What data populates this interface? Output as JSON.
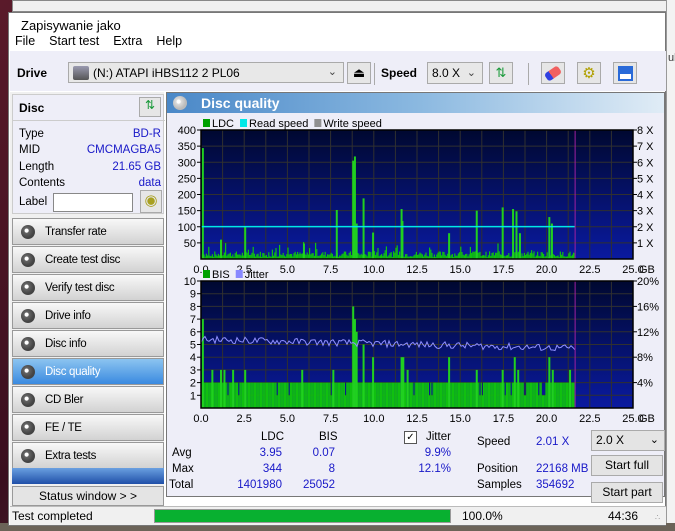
{
  "window": {
    "title": "Zapisywanie jako",
    "side_text": "uk"
  },
  "menu": [
    "File",
    "Start test",
    "Extra",
    "Help"
  ],
  "toolbar": {
    "drive_label": "Drive",
    "drive_value": "(N:)   ATAPI iHBS112   2 PL06",
    "speed_label": "Speed",
    "speed_value": "8.0 X"
  },
  "disc": {
    "header": "Disc",
    "rows": [
      {
        "label": "Type",
        "value": "BD-R"
      },
      {
        "label": "MID",
        "value": "CMCMAGBA5"
      },
      {
        "label": "Length",
        "value": "21.65 GB"
      },
      {
        "label": "Contents",
        "value": "data"
      }
    ],
    "label_field_label": "Label",
    "label_field_value": ""
  },
  "nav": [
    {
      "label": "Transfer rate",
      "active": false
    },
    {
      "label": "Create test disc",
      "active": false
    },
    {
      "label": "Verify test disc",
      "active": false
    },
    {
      "label": "Drive info",
      "active": false
    },
    {
      "label": "Disc info",
      "active": false
    },
    {
      "label": "Disc quality",
      "active": true
    },
    {
      "label": "CD Bler",
      "active": false
    },
    {
      "label": "FE / TE",
      "active": false
    },
    {
      "label": "Extra tests",
      "active": false
    }
  ],
  "status_window_label": "Status window > >",
  "main": {
    "title": "Disc quality"
  },
  "chart_data": [
    {
      "type": "bar",
      "title": "LDC",
      "legend": [
        {
          "name": "LDC",
          "color": "#00a000"
        },
        {
          "name": "Read speed",
          "color": "#00e8e8"
        },
        {
          "name": "Write speed",
          "color": "#909090"
        }
      ],
      "xlabel": "GB",
      "xlim": [
        0,
        25
      ],
      "xticks": [
        "0.0",
        "2.5",
        "5.0",
        "7.5",
        "10.0",
        "12.5",
        "15.0",
        "17.5",
        "20.0",
        "22.5",
        "25.0"
      ],
      "ylim": [
        0,
        400
      ],
      "yticks": [
        "50",
        "100",
        "150",
        "200",
        "250",
        "300",
        "350",
        "400"
      ],
      "y2lim": [
        0,
        8
      ],
      "y2ticks": [
        "1 X",
        "2 X",
        "3 X",
        "4 X",
        "5 X",
        "6 X",
        "7 X",
        "8 X"
      ],
      "disc_end_gb": 21.65,
      "read_speed_x": 2.01,
      "spikes": [
        {
          "x": 0.05,
          "y": 344
        },
        {
          "x": 1.1,
          "y": 60
        },
        {
          "x": 2.5,
          "y": 100
        },
        {
          "x": 5.9,
          "y": 48
        },
        {
          "x": 7.8,
          "y": 152
        },
        {
          "x": 8.75,
          "y": 305
        },
        {
          "x": 8.85,
          "y": 318
        },
        {
          "x": 8.95,
          "y": 110
        },
        {
          "x": 9.35,
          "y": 188
        },
        {
          "x": 9.9,
          "y": 82
        },
        {
          "x": 11.55,
          "y": 155
        },
        {
          "x": 11.6,
          "y": 118
        },
        {
          "x": 14.3,
          "y": 80
        },
        {
          "x": 15.9,
          "y": 150
        },
        {
          "x": 17.4,
          "y": 160
        },
        {
          "x": 18.0,
          "y": 155
        },
        {
          "x": 18.2,
          "y": 148
        },
        {
          "x": 18.4,
          "y": 80
        },
        {
          "x": 20.1,
          "y": 130
        },
        {
          "x": 20.25,
          "y": 110
        }
      ],
      "baseline_avg": 15
    },
    {
      "type": "bar",
      "title": "BIS / Jitter",
      "legend": [
        {
          "name": "BIS",
          "color": "#00a000"
        },
        {
          "name": "Jitter",
          "color": "#8888ff"
        }
      ],
      "xlabel": "GB",
      "xlim": [
        0,
        25
      ],
      "xticks": [
        "0.0",
        "2.5",
        "5.0",
        "7.5",
        "10.0",
        "12.5",
        "15.0",
        "17.5",
        "20.0",
        "22.5",
        "25.0"
      ],
      "ylim": [
        0,
        10
      ],
      "yticks": [
        "1",
        "2",
        "3",
        "4",
        "5",
        "6",
        "7",
        "8",
        "9",
        "10"
      ],
      "y2lim": [
        0,
        20
      ],
      "y2ticks": [
        "4%",
        "8%",
        "12%",
        "16%",
        "20%"
      ],
      "disc_end_gb": 21.65,
      "bis_baseline": 2,
      "bis_spikes": [
        {
          "x": 0.05,
          "y": 7
        },
        {
          "x": 0.6,
          "y": 3
        },
        {
          "x": 1.1,
          "y": 3
        },
        {
          "x": 1.3,
          "y": 3
        },
        {
          "x": 1.8,
          "y": 3
        },
        {
          "x": 2.5,
          "y": 3
        },
        {
          "x": 5.8,
          "y": 3
        },
        {
          "x": 7.6,
          "y": 3
        },
        {
          "x": 8.75,
          "y": 8
        },
        {
          "x": 8.85,
          "y": 7
        },
        {
          "x": 8.95,
          "y": 6
        },
        {
          "x": 9.35,
          "y": 5
        },
        {
          "x": 9.9,
          "y": 4
        },
        {
          "x": 11.55,
          "y": 4
        },
        {
          "x": 11.65,
          "y": 4
        },
        {
          "x": 11.9,
          "y": 3
        },
        {
          "x": 14.3,
          "y": 4
        },
        {
          "x": 15.9,
          "y": 3
        },
        {
          "x": 17.4,
          "y": 3
        },
        {
          "x": 18.1,
          "y": 4
        },
        {
          "x": 18.3,
          "y": 3
        },
        {
          "x": 20.1,
          "y": 4
        },
        {
          "x": 20.3,
          "y": 3
        },
        {
          "x": 21.3,
          "y": 3
        }
      ],
      "jitter_percent_start": 10.8,
      "jitter_percent_end": 9.4,
      "jitter_percent_avg": 9.9
    }
  ],
  "stats": {
    "col_ldc": "LDC",
    "col_bis": "BIS",
    "jitter_label": "Jitter",
    "jitter_checked": true,
    "rows": [
      {
        "label": "Avg",
        "ldc": "3.95",
        "bis": "0.07",
        "jitter": "9.9%"
      },
      {
        "label": "Max",
        "ldc": "344",
        "bis": "8",
        "jitter": "12.1%"
      },
      {
        "label": "Total",
        "ldc": "1401980",
        "bis": "25052",
        "jitter": ""
      }
    ],
    "speed_label": "Speed",
    "speed_value": "2.01 X",
    "position_label": "Position",
    "position_value": "22168 MB",
    "samples_label": "Samples",
    "samples_value": "354692",
    "speed_select": "2.0 X",
    "start_full": "Start full",
    "start_part": "Start part"
  },
  "statusbar": {
    "text": "Test completed",
    "progress": 100.0,
    "progress_text": "100.0%",
    "time": "44:36"
  }
}
